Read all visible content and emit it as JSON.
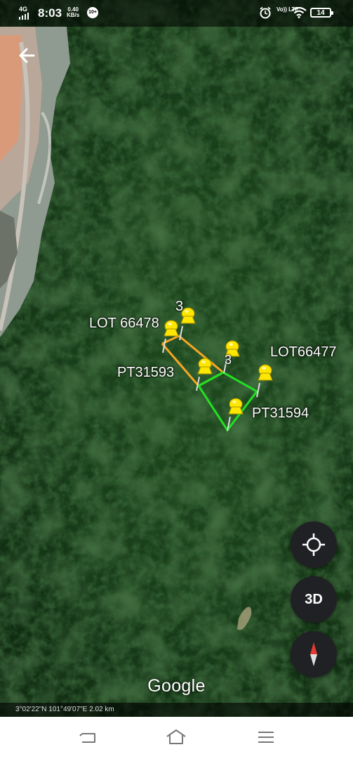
{
  "status_bar": {
    "network": "4G",
    "time": "8:03",
    "speed_value": "0.40",
    "speed_unit": "KB/s",
    "notification_badge": "10+",
    "volte": "Vo)) LTE",
    "battery": "14"
  },
  "map": {
    "labels": {
      "lot_66478": "LOT 66478",
      "lot_66477": "LOT66477",
      "pt_31593": "PT31593",
      "pt_31594": "PT31594",
      "vertex_a": "3",
      "vertex_b": "3"
    },
    "polygon_colors": {
      "orange": "#f5a623",
      "green": "#22e022"
    },
    "pin_color": "#ffe600"
  },
  "controls": {
    "locate": "locate-icon",
    "three_d_label": "3D",
    "compass": "compass-icon"
  },
  "attribution": "Google",
  "scale_text": "3°02'22\"N 101°49'07\"E 2.02 km",
  "nav_bar": [
    "back",
    "home",
    "menu"
  ]
}
